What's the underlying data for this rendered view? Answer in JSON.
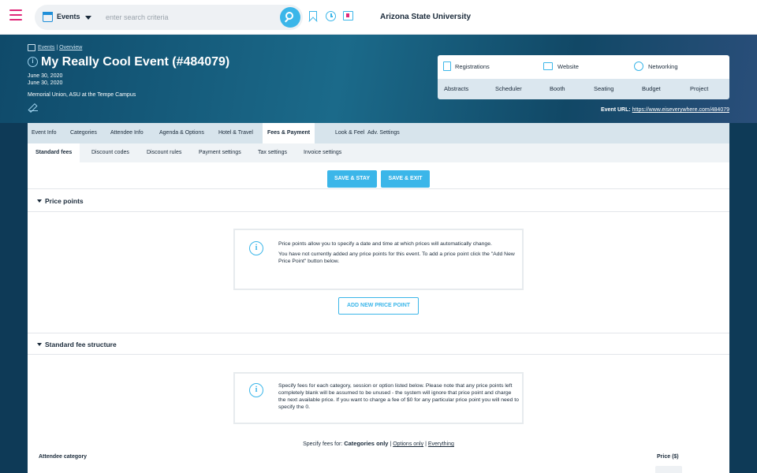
{
  "topbar": {
    "module_label": "Events",
    "search_placeholder": "enter search criteria",
    "org_name": "Arizona State University"
  },
  "header": {
    "breadcrumb": [
      "Events",
      "Overview"
    ],
    "title": "My Really Cool Event (#484079)",
    "start_date": "June 30, 2020",
    "end_date": "June 30, 2020",
    "venue": "Memorial Union, ASU at the Tempe Campus",
    "quicknav_top": [
      "Registrations",
      "Website",
      "Networking"
    ],
    "quicknav_bottom": [
      "Abstracts",
      "Scheduler",
      "Booth",
      "Seating",
      "Budget",
      "Project"
    ],
    "url_label": "Event URL:",
    "url_value": "https://www.eiseverywhere.com/484079"
  },
  "tabs": {
    "main": [
      "Event Info",
      "Categories",
      "Attendee Info",
      "Agenda & Options",
      "Hotel & Travel",
      "Fees & Payment",
      "Look & Feel",
      "Adv. Settings"
    ],
    "main_active": "Fees & Payment",
    "sub": [
      "Standard fees",
      "Discount codes",
      "Discount rules",
      "Payment settings",
      "Tax settings",
      "Invoice settings"
    ],
    "sub_active": "Standard fees"
  },
  "actions": {
    "save_stay": "SAVE & STAY",
    "save_exit": "SAVE & EXIT"
  },
  "price_points": {
    "title": "Price points",
    "info_p1": "Price points allow you to specify a date and time at which prices will automatically change.",
    "info_p2": "You have not currently added any price points for this event. To add a price point click the \"Add New Price Point\" button below.",
    "add_button": "ADD NEW PRICE POINT"
  },
  "fee_structure": {
    "title": "Standard fee structure",
    "info": "Specify fees for each category, session or option listed below. Please note that any price points left completely blank will be assumed to be unused - the system will ignore that price point and charge the next available price. If you want to charge a fee of $0 for any particular price point you will need to specify the 0.",
    "specify_prefix": "Specify fees for:",
    "specify_current": "Categories only",
    "specify_options": [
      "Options only",
      "Everything"
    ],
    "col_category": "Attendee category",
    "col_price": "Price ($)"
  },
  "colors": {
    "accent": "#3bb6e9",
    "brand_pink": "#e0297a",
    "header_bg": "#1b6a8a"
  }
}
